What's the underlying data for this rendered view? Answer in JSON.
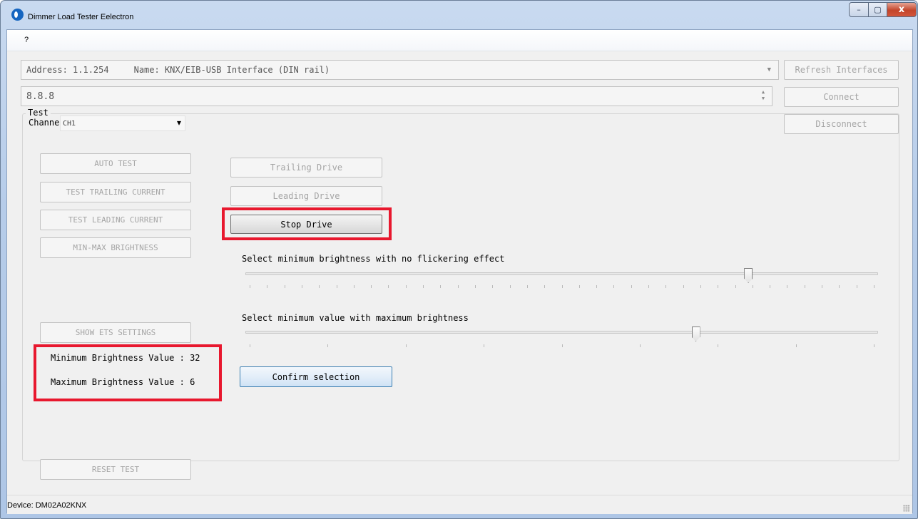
{
  "window": {
    "title": "Dimmer Load Tester Eelectron",
    "controls": {
      "minimize": "–",
      "maximize": "▢",
      "close": "x"
    }
  },
  "menu": {
    "help": "?"
  },
  "interface": {
    "address_label": "Address: 1.1.254",
    "name_label": "Name: KNX/EIB-USB Interface (DIN rail)",
    "refresh_button": "Refresh Interfaces",
    "ip_value": "8.8.8",
    "connect_button": "Connect",
    "disconnect_button": "Disconnect"
  },
  "channel": {
    "label": "Channel",
    "value": "CH1"
  },
  "test_group": {
    "title": "Test",
    "buttons": {
      "auto_test": "AUTO TEST",
      "test_trailing": "TEST TRAILING CURRENT",
      "test_leading": "TEST LEADING CURRENT",
      "min_max": "MIN-MAX BRIGHTNESS",
      "show_ets": "SHOW ETS SETTINGS",
      "reset_test": "RESET TEST"
    },
    "drive": {
      "trailing": "Trailing Drive",
      "leading": "Leading Drive",
      "stop": "Stop Drive"
    },
    "slider_min": {
      "label": "Select minimum brightness with no flickering effect",
      "position_fraction": 0.795,
      "tick_count": 36
    },
    "slider_max": {
      "label": "Select minimum value with maximum brightness",
      "position_fraction": 0.712,
      "tick_count": 8
    },
    "confirm_button": "Confirm selection",
    "min_brightness": "Minimum Brightness Value : 32",
    "max_brightness": "Maximum Brightness Value : 6"
  },
  "status": {
    "device": "Device: DM02A02KNX"
  },
  "colors": {
    "highlight": "#e8182e",
    "accent_blue": "#3c7fb1"
  }
}
